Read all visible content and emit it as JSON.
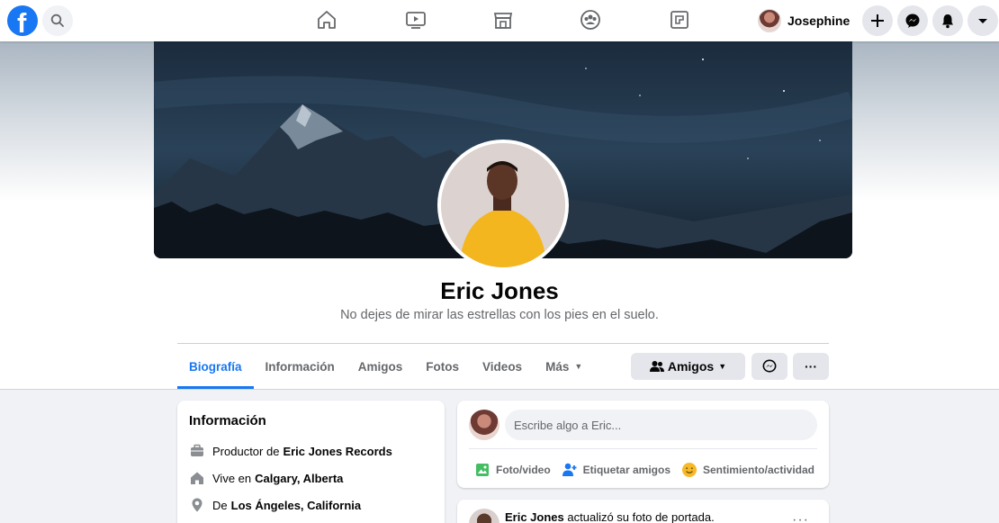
{
  "nav": {
    "logo": "f",
    "user_name": "Josephine",
    "icons": [
      "home-icon",
      "watch-icon",
      "marketplace-icon",
      "groups-icon",
      "gaming-icon"
    ]
  },
  "profile": {
    "name": "Eric Jones",
    "bio": "No dejes de mirar las estrellas con los pies en el suelo."
  },
  "tabs": [
    {
      "label": "Biografía",
      "active": true
    },
    {
      "label": "Información"
    },
    {
      "label": "Amigos"
    },
    {
      "label": "Fotos"
    },
    {
      "label": "Videos"
    },
    {
      "label": "Más"
    }
  ],
  "actions": {
    "friends_label": "Amigos",
    "more_label": "···"
  },
  "info": {
    "title": "Información",
    "rows": [
      {
        "prefix": "Productor de",
        "value": "Eric Jones Records"
      },
      {
        "prefix": "Vive en",
        "value": "Calgary, Alberta"
      },
      {
        "prefix": "De",
        "value": "Los Ángeles, California"
      }
    ]
  },
  "composer": {
    "placeholder": "Escribe algo a Eric...",
    "actions": [
      "Foto/video",
      "Etiquetar amigos",
      "Sentimiento/actividad"
    ]
  },
  "post": {
    "author": "Eric Jones",
    "text": "actualizó su foto de portada.",
    "more": "···"
  },
  "colors": {
    "brand": "#1877f2",
    "photo_green": "#45bd62",
    "tag_blue": "#1877f2",
    "feeling_yellow": "#f7b928"
  }
}
